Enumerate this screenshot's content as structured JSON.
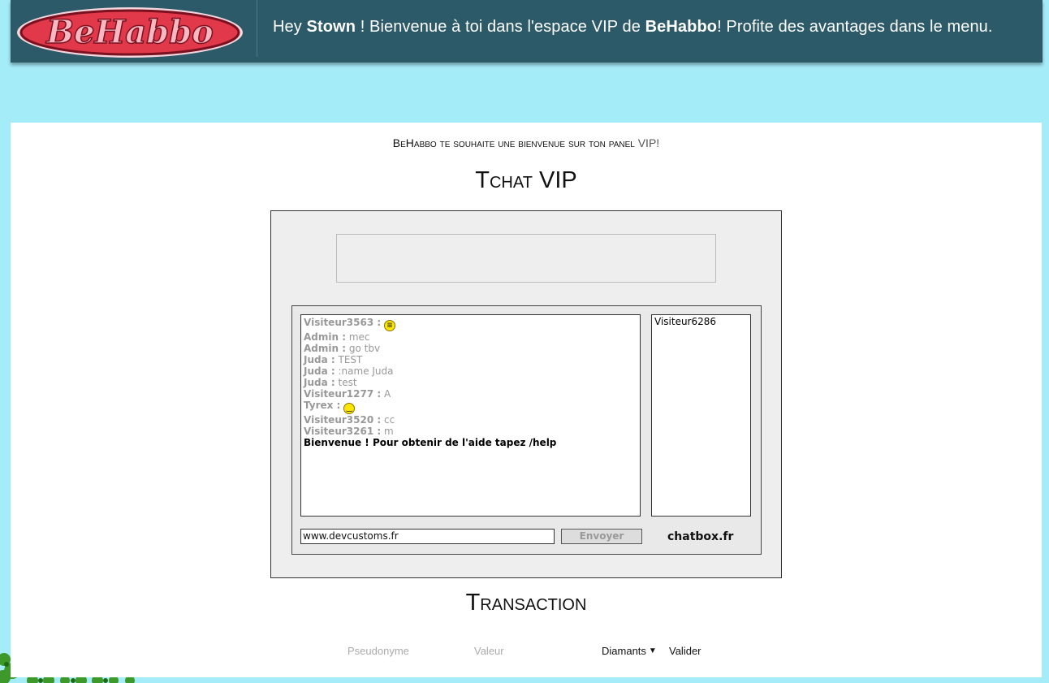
{
  "header": {
    "logo_text": "BeHabbo",
    "welcome": {
      "greeting": "Hey ",
      "username": "Stown",
      "part2": " ! Bienvenue à toi dans l'espace VIP de ",
      "site": "BeHabbo",
      "part3": "! Profite des avantages dans le menu."
    }
  },
  "intro": {
    "site": "BeHabbo",
    "text": " te souhaite une bienvenue sur ton panel ",
    "vip": "VIP!"
  },
  "chat": {
    "title": "Tchat VIP",
    "messages": [
      {
        "user": "Visiteur3563 :",
        "text": "",
        "icon": "grin-smiley-icon"
      },
      {
        "user": "Admin :",
        "text": "mec"
      },
      {
        "user": "Admin :",
        "text": "go tbv"
      },
      {
        "user": "Juda :",
        "text": "TEST"
      },
      {
        "user": "Juda :",
        "text": ":name Juda"
      },
      {
        "user": "Juda :",
        "text": "test"
      },
      {
        "user": "Visiteur1277 :",
        "text": "A"
      },
      {
        "user": "Tyrex :",
        "text": "",
        "icon": "smile-smiley-icon"
      },
      {
        "user": "Visiteur3520 :",
        "text": "cc"
      },
      {
        "user": "Visiteur3261 :",
        "text": "m"
      }
    ],
    "system_message": "Bienvenue ! Pour obtenir de l'aide tapez /help",
    "users": [
      "Visiteur6286"
    ],
    "input_value": "www.devcustoms.fr",
    "send_label": "Envoyer",
    "brand": "chatbox.fr"
  },
  "transaction": {
    "title": "Transaction",
    "pseudo_placeholder": "Pseudonyme",
    "value_placeholder": "Valeur",
    "currency_selected": "Diamants",
    "submit_label": "Valider"
  },
  "colors": {
    "background": "#a5ecf9",
    "header": "#2c5a69",
    "logo_red": "#e2394a"
  }
}
